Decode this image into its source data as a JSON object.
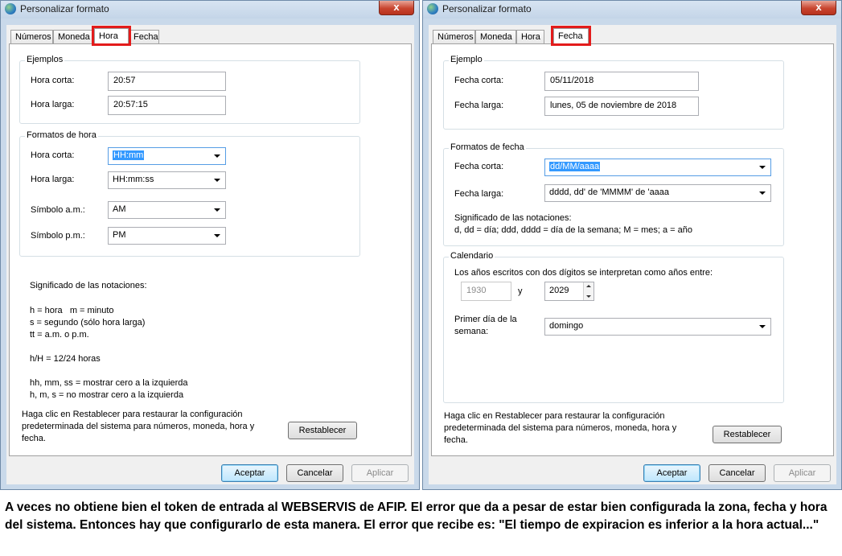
{
  "left": {
    "title": "Personalizar formato",
    "close": "x",
    "tabs": [
      "Números",
      "Moneda",
      "Hora",
      "Fecha"
    ],
    "active_tab": "Hora",
    "examples": {
      "title": "Ejemplos",
      "short_label": "Hora corta:",
      "short_value": "20:57",
      "long_label": "Hora larga:",
      "long_value": "20:57:15"
    },
    "formats": {
      "title": "Formatos de hora",
      "short_label": "Hora corta:",
      "short_value": "HH:mm",
      "long_label": "Hora larga:",
      "long_value": "HH:mm:ss",
      "am_label": "Símbolo a.m.:",
      "am_value": "AM",
      "pm_label": "Símbolo p.m.:",
      "pm_value": "PM"
    },
    "notation_title": "Significado de las notaciones:",
    "notation_lines": "h = hora   m = minuto\ns = segundo (sólo hora larga)\ntt = a.m. o p.m.\n\nh/H = 12/24 horas\n\nhh, mm, ss = mostrar cero a la izquierda\nh, m, s = no mostrar cero a la izquierda",
    "reset_text": "Haga clic en Restablecer para restaurar la configuración\npredeterminada del sistema para números, moneda, hora y\nfecha.",
    "reset_button": "Restablecer",
    "ok": "Aceptar",
    "cancel": "Cancelar",
    "apply": "Aplicar"
  },
  "right": {
    "title": "Personalizar formato",
    "close": "x",
    "tabs": [
      "Números",
      "Moneda",
      "Hora",
      "Fecha"
    ],
    "active_tab": "Fecha",
    "examples": {
      "title": "Ejemplo",
      "short_label": "Fecha corta:",
      "short_value": "05/11/2018",
      "long_label": "Fecha larga:",
      "long_value": "lunes, 05 de noviembre de 2018"
    },
    "formats": {
      "title": "Formatos de fecha",
      "short_label": "Fecha corta:",
      "short_value": "dd/MM/aaaa",
      "long_label": "Fecha larga:",
      "long_value": "dddd, dd' de 'MMMM' de 'aaaa",
      "notation_title": "Significado de las notaciones:",
      "notation_line": "d, dd = día;  ddd, dddd = día de la semana; M = mes; a = año"
    },
    "calendar": {
      "title": "Calendario",
      "desc": "Los años escritos con dos dígitos se interpretan como años entre:",
      "from_year": "1930",
      "and": "y",
      "to_year": "2029",
      "first_day_label": "Primer día de la\nsemana:",
      "first_day_value": "domingo"
    },
    "reset_text": "Haga clic en Restablecer para restaurar la configuración\npredeterminada del sistema para números, moneda, hora y\nfecha.",
    "reset_button": "Restablecer",
    "ok": "Aceptar",
    "cancel": "Cancelar",
    "apply": "Aplicar"
  },
  "caption": "A veces no obtiene bien el token de entrada al WEBSERVIS de AFIP. El error que da a pesar de estar bien configurada la zona, fecha y hora del sistema. Entonces hay que configurarlo de esta manera. El error que recibe es: \"El tiempo de expiracion es inferior a la hora actual...\""
}
